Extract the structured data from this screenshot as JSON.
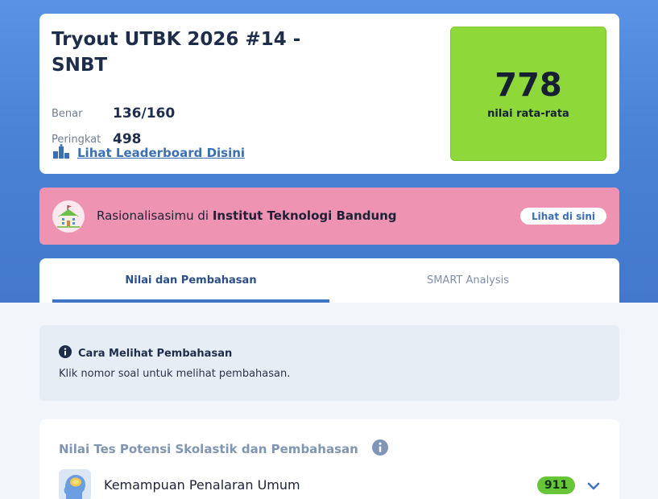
{
  "result": {
    "title": "Tryout UTBK 2026 #14 - SNBT",
    "benar_label": "Benar",
    "benar_value": "136/160",
    "peringkat_label": "Peringkat",
    "peringkat_value": "498",
    "leaderboard_link": "Lihat Leaderboard Disini",
    "score": "778",
    "score_caption": "nilai rata-rata"
  },
  "banner": {
    "text_prefix": "Rasionalisasimu di ",
    "campus": "Institut Teknologi Bandung",
    "button": "Lihat di sini"
  },
  "tabs": [
    {
      "label": "Nilai dan Pembahasan",
      "active": true
    },
    {
      "label": "SMART Analysis",
      "active": false
    }
  ],
  "info": {
    "title": "Cara Melihat Pembahasan",
    "body": "Klik nomor soal untuk melihat pembahasan."
  },
  "panel": {
    "title": "Nilai Tes Potensi Skolastik dan Pembahasan",
    "subtests": [
      {
        "name": "Kemampuan Penalaran Umum",
        "score": "911"
      }
    ]
  },
  "colors": {
    "score_box": "#8fd83a",
    "banner": "#ef93b2",
    "accent": "#3f74c4",
    "score_pill": "#67c538"
  },
  "icons": [
    "leaderboard-icon",
    "school-icon",
    "info-icon",
    "brain-head-icon",
    "chevron-down-icon"
  ]
}
